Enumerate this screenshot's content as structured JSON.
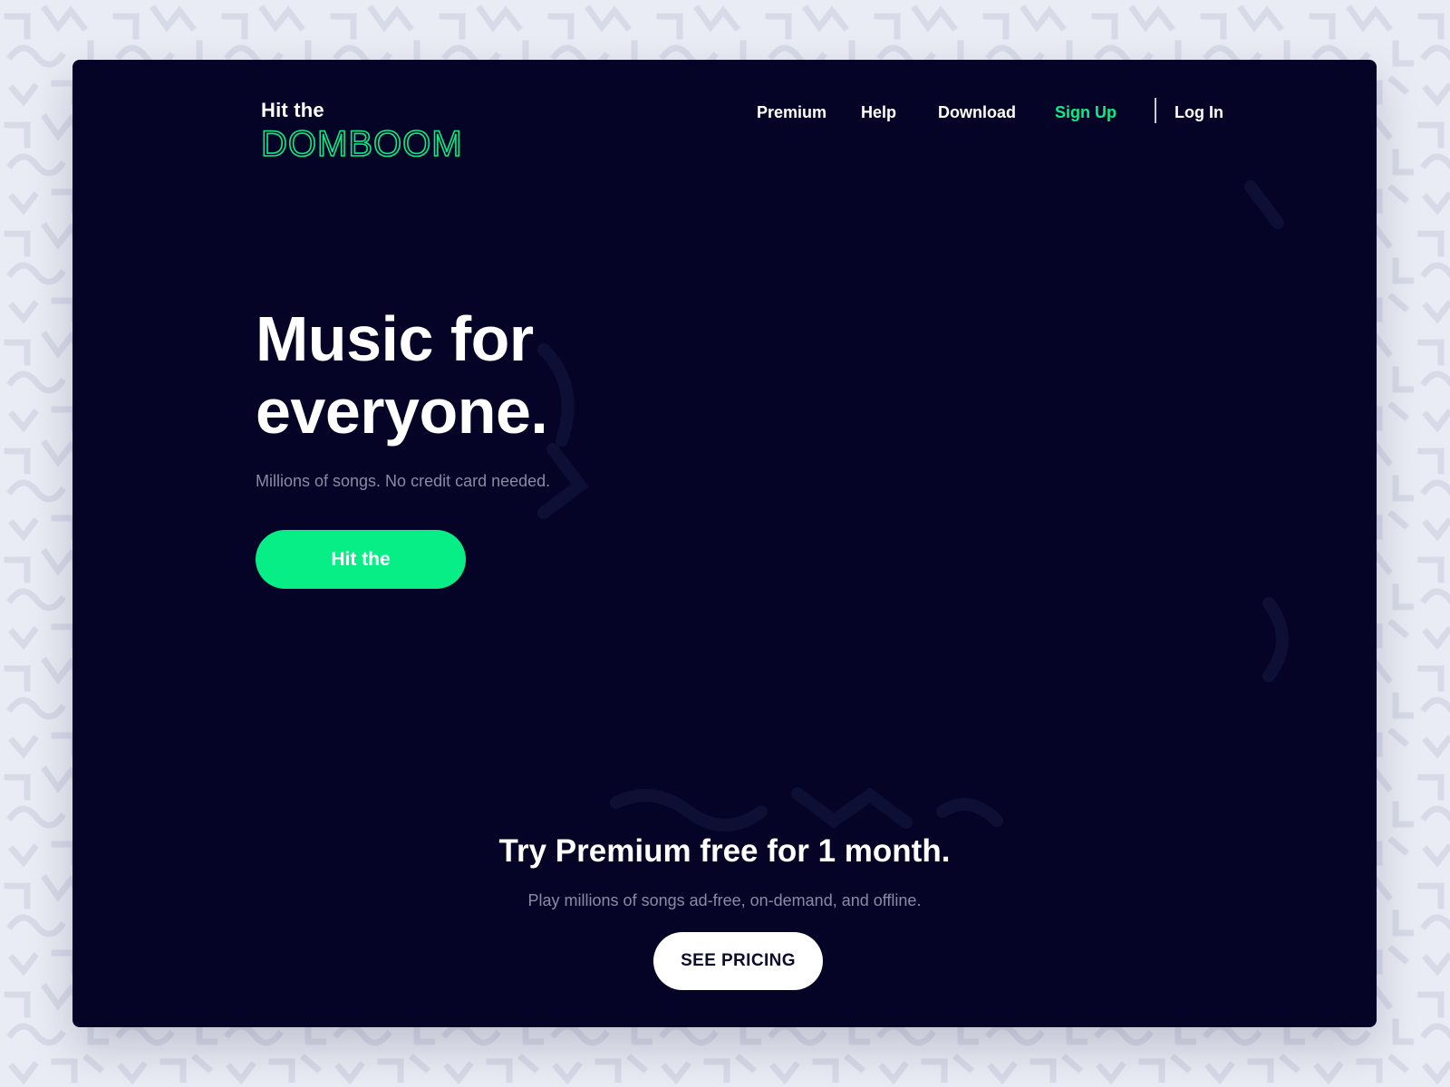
{
  "brand": {
    "top_text": "Hit the",
    "wordmark": "DOMBOOM"
  },
  "nav": {
    "items": [
      {
        "label": "Premium"
      },
      {
        "label": "Help"
      },
      {
        "label": "Download"
      },
      {
        "label": "Sign Up"
      },
      {
        "label": "Log In"
      }
    ]
  },
  "hero": {
    "title_line1": "Music for",
    "title_line2": "everyone.",
    "subtitle": "Millions of songs. No credit card needed.",
    "cta_label": "Hit the"
  },
  "promo": {
    "title": "Try Premium free for 1 month.",
    "subtitle": "Play millions of songs ad-free, on-demand, and offline.",
    "button_label": "SEE PRICING"
  },
  "colors": {
    "page_background": "#e9ecf4",
    "window_background": "#050426",
    "accent_green": "#07ee86",
    "text_white": "#ffffff",
    "text_muted": "#8b8aa4"
  }
}
